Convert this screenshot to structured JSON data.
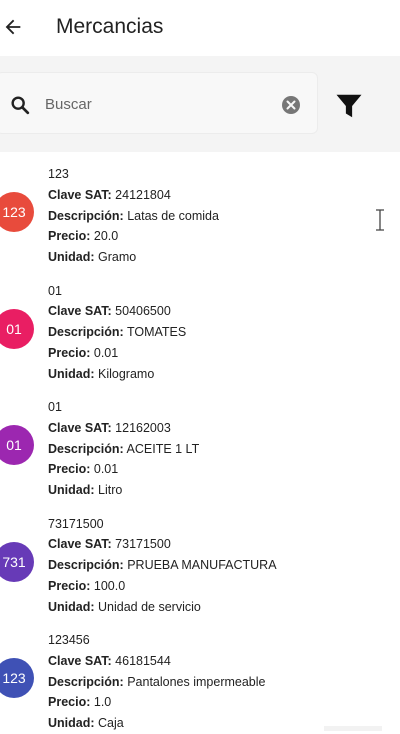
{
  "header": {
    "title": "Mercancias"
  },
  "search": {
    "placeholder": "Buscar",
    "value": ""
  },
  "labels": {
    "clave": "Clave SAT:",
    "descripcion": "Descripción:",
    "precio": "Precio:",
    "unidad": "Unidad:"
  },
  "items": [
    {
      "avatar": "123",
      "color": "#e84b3c",
      "code": "123",
      "clave": "24121804",
      "descripcion": "Latas de comida",
      "precio": "20.0",
      "unidad": "Gramo"
    },
    {
      "avatar": "01",
      "color": "#e91e63",
      "code": "01",
      "clave": "50406500",
      "descripcion": "TOMATES",
      "precio": "0.01",
      "unidad": "Kilogramo"
    },
    {
      "avatar": "01",
      "color": "#9c27b0",
      "code": "01",
      "clave": "12162003",
      "descripcion": "ACEITE 1 LT",
      "precio": "0.01",
      "unidad": "Litro"
    },
    {
      "avatar": "731",
      "color": "#673ab7",
      "code": "73171500",
      "clave": "73171500",
      "descripcion": "PRUEBA MANUFACTURA",
      "precio": "100.0",
      "unidad": "Unidad de servicio"
    },
    {
      "avatar": "123",
      "color": "#3f51b5",
      "code": "123456",
      "clave": "46181544",
      "descripcion": "Pantalones impermeable",
      "precio": "1.0",
      "unidad": "Caja"
    }
  ]
}
